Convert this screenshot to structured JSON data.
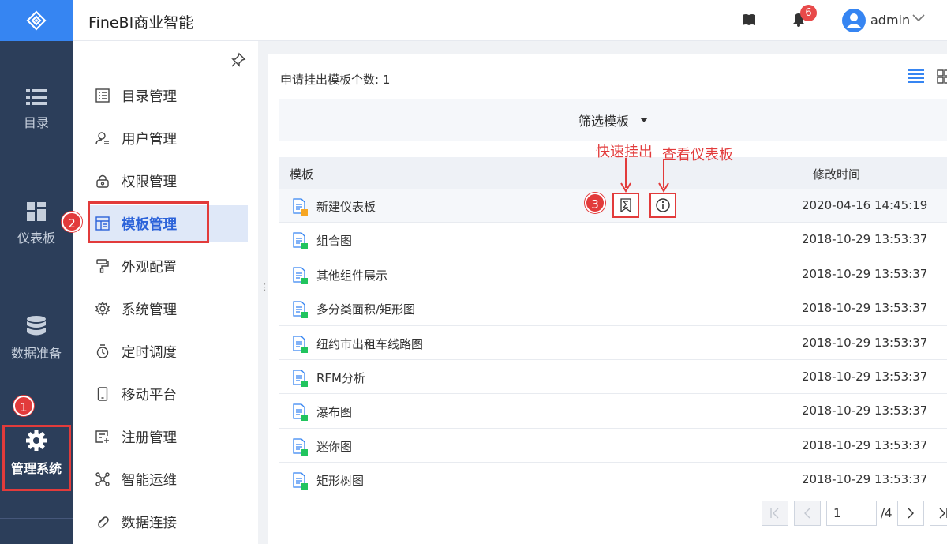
{
  "app": {
    "title": "FineBI商业智能"
  },
  "rail": {
    "items": [
      {
        "label": "目录",
        "icon": "list-icon"
      },
      {
        "label": "仪表板",
        "icon": "dashboard-icon"
      },
      {
        "label": "数据准备",
        "icon": "database-icon"
      },
      {
        "label": "管理系统",
        "icon": "gear-icon",
        "active": true
      }
    ]
  },
  "header": {
    "notification_count": "6",
    "user": "admin"
  },
  "subnav": {
    "items": [
      {
        "label": "目录管理",
        "icon": "catalog-icon"
      },
      {
        "label": "用户管理",
        "icon": "user-icon"
      },
      {
        "label": "权限管理",
        "icon": "lock-icon"
      },
      {
        "label": "模板管理",
        "icon": "template-icon",
        "active": true
      },
      {
        "label": "外观配置",
        "icon": "paint-roller-icon"
      },
      {
        "label": "系统管理",
        "icon": "system-gear-icon"
      },
      {
        "label": "定时调度",
        "icon": "timer-icon"
      },
      {
        "label": "移动平台",
        "icon": "mobile-icon"
      },
      {
        "label": "注册管理",
        "icon": "register-icon"
      },
      {
        "label": "智能运维",
        "icon": "network-icon"
      },
      {
        "label": "数据连接",
        "icon": "link-icon"
      }
    ]
  },
  "main": {
    "count_text": "申请挂出模板个数: 1",
    "filter_label": "筛选模板",
    "columns": {
      "name": "模板",
      "time": "修改时间"
    },
    "rows": [
      {
        "name": "新建仪表板",
        "time": "2020-04-16 14:45:19",
        "tag": "orange"
      },
      {
        "name": "组合图",
        "time": "2018-10-29 13:53:37",
        "tag": "green"
      },
      {
        "name": "其他组件展示",
        "time": "2018-10-29 13:53:37",
        "tag": "green"
      },
      {
        "name": "多分类面积/矩形图",
        "time": "2018-10-29 13:53:37",
        "tag": "green"
      },
      {
        "name": "纽约市出租车线路图",
        "time": "2018-10-29 13:53:37",
        "tag": "green"
      },
      {
        "name": "RFM分析",
        "time": "2018-10-29 13:53:37",
        "tag": "green"
      },
      {
        "name": "瀑布图",
        "time": "2018-10-29 13:53:37",
        "tag": "green"
      },
      {
        "name": "迷你图",
        "time": "2018-10-29 13:53:37",
        "tag": "green"
      },
      {
        "name": "矩形树图",
        "time": "2018-10-29 13:53:37",
        "tag": "green"
      }
    ],
    "pager": {
      "current": "1",
      "total": "/4"
    }
  },
  "annotations": {
    "step1": "1",
    "step2": "2",
    "step3": "3",
    "quick_unpublish": "快速挂出",
    "view_dashboard": "查看仪表板"
  },
  "colors": {
    "accent": "#3685f2",
    "rail_bg": "#2c3e5a",
    "annotation_red": "#e23b3b",
    "tag_green": "#21c45e",
    "tag_orange": "#f6a623"
  }
}
